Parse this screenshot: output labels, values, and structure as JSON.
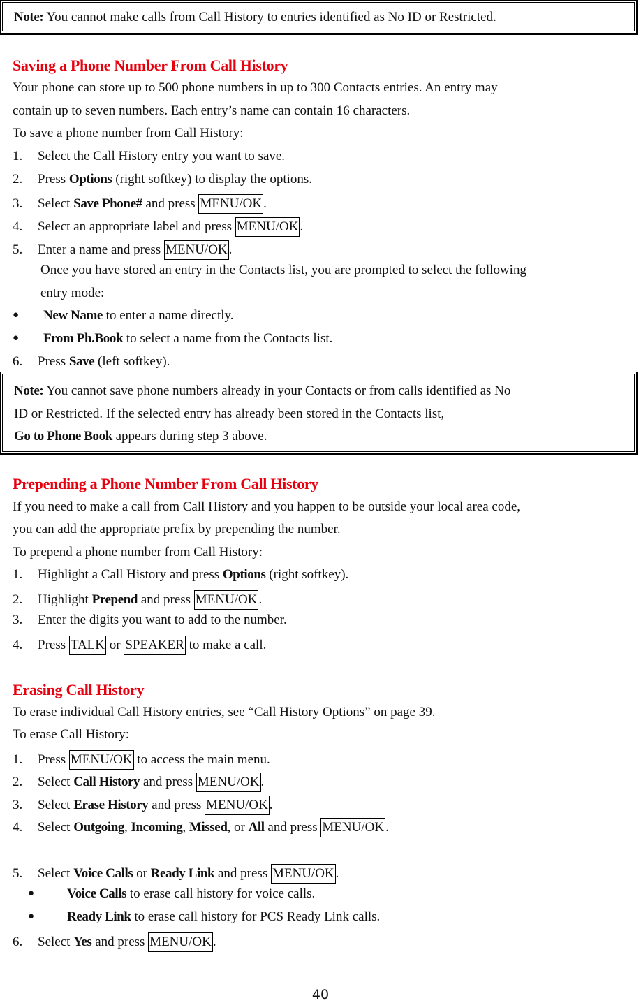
{
  "note_top": {
    "label": "Note:",
    "text": " You cannot make calls from Call History to entries identified as No ID or Restricted."
  },
  "saving": {
    "heading": "Saving a Phone Number From Call History",
    "intro_1": "Your phone can store up to 500 phone numbers in up to 300 Contacts entries. An entry may",
    "intro_2": "contain up to seven numbers. Each entry’s name can contain 16 characters.",
    "lead": "To save a phone number from Call History:",
    "step1": {
      "n": "1.",
      "text": "Select the Call History entry you want to save."
    },
    "step2": {
      "n": "2.",
      "pre": "Press ",
      "bold": "Options",
      "post": " (right softkey) to display the options."
    },
    "step3": {
      "n": "3.",
      "pre": "Select ",
      "bold": "Save Phone#",
      "mid": " and press ",
      "key": "MENU/OK",
      "post": "."
    },
    "step4": {
      "n": "4.",
      "pre": "Select an appropriate label and press ",
      "key": "MENU/OK",
      "post": "."
    },
    "step5": {
      "n": "5.",
      "pre": "Enter a name and press ",
      "key": "MENU/OK",
      "post": "."
    },
    "step5_detail_1": "Once you have stored an entry in the Contacts list, you are prompted to select the following",
    "step5_detail_2": "entry mode:",
    "bullet1": {
      "bold": "New Name",
      "text": " to enter a name directly."
    },
    "bullet2": {
      "bold": "From Ph.Book",
      "text": " to select a name from the Contacts list."
    },
    "step6": {
      "n": "6.",
      "pre": "Press ",
      "bold": "Save",
      "post": " (left softkey)."
    }
  },
  "note_save": {
    "label": "Note:",
    "line1": " You cannot save phone numbers already in your Contacts or from calls identified as No",
    "line2": "ID or Restricted. If the selected entry has already been stored in the Contacts list,",
    "bold3": "Go to Phone Book",
    "line3": " appears during step 3 above."
  },
  "prepending": {
    "heading": "Prepending a Phone Number From Call History",
    "intro_1": "If you need to make a call from Call History and you happen to be outside your local area code,",
    "intro_2": "you can add the appropriate prefix by prepending the number.",
    "lead": "To prepend a phone number from Call History:",
    "step1": {
      "n": "1.",
      "pre": "Highlight a Call History and press ",
      "bold": "Options",
      "post": " (right softkey)."
    },
    "step2": {
      "n": "2.",
      "pre": "Highlight ",
      "bold": "Prepend",
      "mid": " and press ",
      "key": "MENU/OK",
      "post": "."
    },
    "step3": {
      "n": "3.",
      "text": "Enter the digits you want to add to the number."
    },
    "step4": {
      "n": "4.",
      "pre": "Press ",
      "key1": "TALK",
      "mid": " or ",
      "key2": "SPEAKER",
      "post": " to make a call."
    }
  },
  "erasing": {
    "heading": "Erasing Call History",
    "intro": "To erase individual Call History entries, see “Call History Options” on page 39.",
    "lead": "To erase Call History:",
    "step1": {
      "n": "1.",
      "pre": "Press ",
      "key": "MENU/OK",
      "post": " to access the main menu."
    },
    "step2": {
      "n": "2.",
      "pre": "Select ",
      "bold": "Call History",
      "mid": " and press ",
      "key": "MENU/OK",
      "post": "."
    },
    "step3": {
      "n": "3.",
      "pre": "Select ",
      "bold": "Erase History",
      "mid": " and press ",
      "key": "MENU/OK",
      "post": "."
    },
    "step4": {
      "n": "4.",
      "pre": "Select ",
      "b1": "Outgoing",
      "s1": ", ",
      "b2": "Incoming",
      "s2": ", ",
      "b3": "Missed",
      "s3": ", or ",
      "b4": "All",
      "mid": " and press ",
      "key": "MENU/OK",
      "post": "."
    },
    "step5": {
      "n": "5.",
      "pre": "Select ",
      "b1": "Voice Calls",
      "s1": " or ",
      "b2": "Ready Link",
      "mid": " and press ",
      "key": "MENU/OK",
      "post": "."
    },
    "bullet1": {
      "bold": "Voice Calls",
      "text": " to erase call history for voice calls."
    },
    "bullet2": {
      "bold": "Ready Link",
      "text": " to erase call history for PCS Ready Link calls."
    },
    "step6": {
      "n": "6.",
      "pre": "Select ",
      "bold": "Yes",
      "mid": " and press ",
      "key": "MENU/OK",
      "post": "."
    }
  },
  "bullet_glyph": "●",
  "page_number": "40"
}
